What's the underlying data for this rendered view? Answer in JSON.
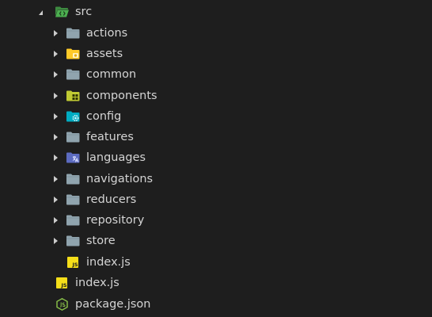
{
  "tree": {
    "root": {
      "name": "src",
      "icon": "folder-src-open-icon",
      "expanded": true
    },
    "children": [
      {
        "name": "actions",
        "icon": "folder-icon",
        "color": "#90a4ae"
      },
      {
        "name": "assets",
        "icon": "folder-assets-icon",
        "color": "#ffca28"
      },
      {
        "name": "common",
        "icon": "folder-icon",
        "color": "#90a4ae"
      },
      {
        "name": "components",
        "icon": "folder-components-icon",
        "color": "#c0ca33"
      },
      {
        "name": "config",
        "icon": "folder-config-icon",
        "color": "#00bcd4"
      },
      {
        "name": "features",
        "icon": "folder-icon",
        "color": "#90a4ae"
      },
      {
        "name": "languages",
        "icon": "folder-languages-icon",
        "color": "#5c6bc0"
      },
      {
        "name": "navigations",
        "icon": "folder-icon",
        "color": "#90a4ae"
      },
      {
        "name": "reducers",
        "icon": "folder-icon",
        "color": "#90a4ae"
      },
      {
        "name": "repository",
        "icon": "folder-icon",
        "color": "#90a4ae"
      },
      {
        "name": "store",
        "icon": "folder-icon",
        "color": "#90a4ae"
      }
    ],
    "src_file": {
      "name": "index.js",
      "icon": "javascript-file-icon"
    },
    "root_files": [
      {
        "name": "index.js",
        "icon": "javascript-file-icon"
      },
      {
        "name": "package.json",
        "icon": "nodejs-file-icon"
      }
    ]
  },
  "colors": {
    "background": "#1e1e1e",
    "text": "#d4d4d4",
    "arrow": "#cccccc",
    "src_folder": "#4caf50",
    "js_badge": "#f5de19",
    "node_green": "#8bc34a"
  }
}
